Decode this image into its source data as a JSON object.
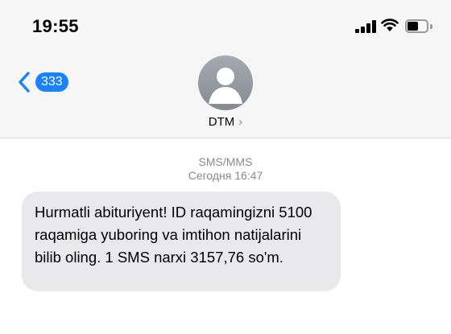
{
  "status_bar": {
    "time": "19:55",
    "battery_level": 0.55
  },
  "nav": {
    "back_badge": "333",
    "contact_name": "DTM",
    "chevron": "›"
  },
  "thread": {
    "service": "SMS/MMS",
    "timestamp": "Сегодня 16:47",
    "messages": [
      {
        "direction": "incoming",
        "text": "Hurmatli abituriyent! ID raqamingizni 5100 raqamiga yuboring va imtihon natijalarini bilib oling. 1 SMS narxi 3157,76 so'm."
      }
    ]
  },
  "colors": {
    "accent": "#1a82fb",
    "bubble": "#e9e9eb",
    "header_bg": "#f6f6f6",
    "meta_text": "#8a8a8e"
  },
  "icons": [
    "signal-icon",
    "wifi-icon",
    "battery-icon",
    "back-chevron-icon",
    "contact-avatar-icon",
    "chevron-right-icon"
  ]
}
